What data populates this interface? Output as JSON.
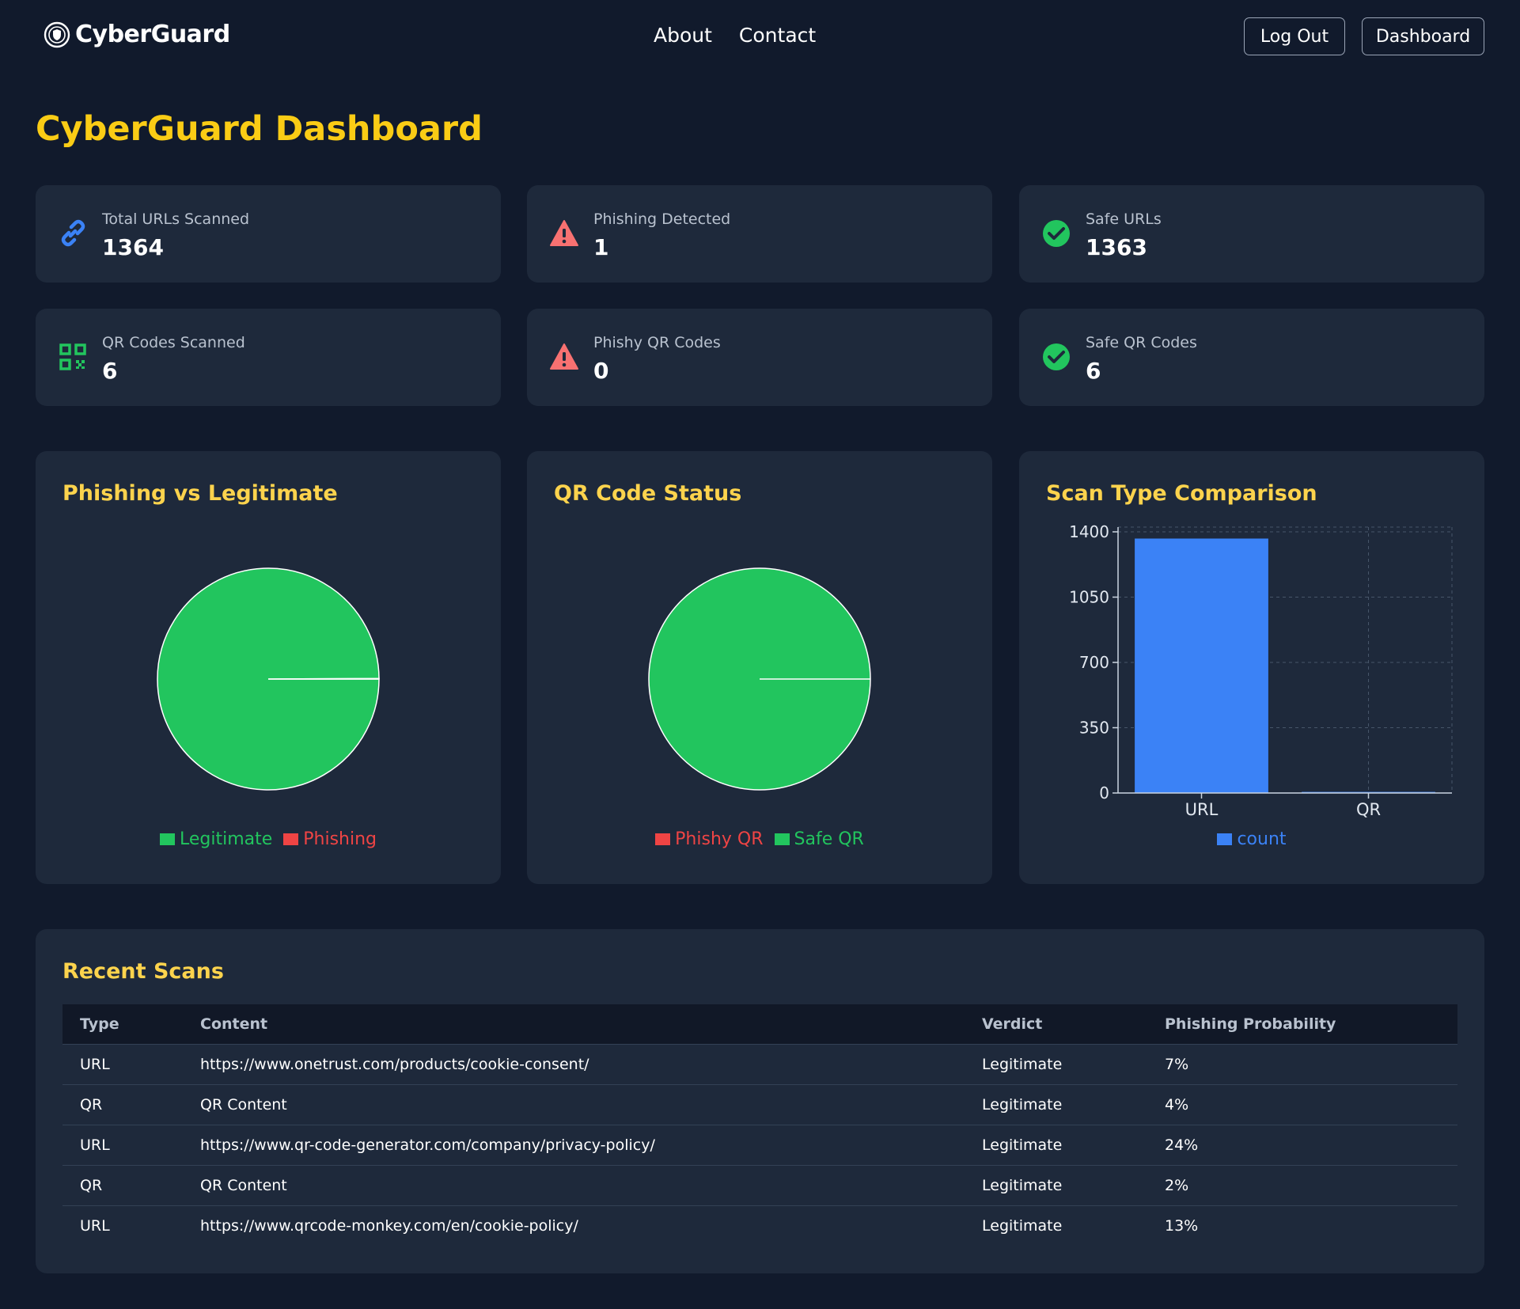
{
  "nav": {
    "brand": "CyberGuard",
    "links": [
      "About",
      "Contact"
    ],
    "logout_label": "Log Out",
    "dashboard_label": "Dashboard"
  },
  "page_title": "CyberGuard Dashboard",
  "stats": [
    {
      "label": "Total URLs Scanned",
      "value": "1364",
      "icon": "link-icon",
      "color": "#3b82f6"
    },
    {
      "label": "Phishing Detected",
      "value": "1",
      "icon": "warning-icon",
      "color": "#f87171"
    },
    {
      "label": "Safe URLs",
      "value": "1363",
      "icon": "check-circle-icon",
      "color": "#22c55e"
    },
    {
      "label": "QR Codes Scanned",
      "value": "6",
      "icon": "qr-code-icon",
      "color": "#22c55e"
    },
    {
      "label": "Phishy QR Codes",
      "value": "0",
      "icon": "warning-icon",
      "color": "#f87171"
    },
    {
      "label": "Safe QR Codes",
      "value": "6",
      "icon": "check-circle-icon",
      "color": "#22c55e"
    }
  ],
  "chart_data": [
    {
      "type": "pie",
      "title": "Phishing vs Legitimate",
      "categories": [
        "Legitimate",
        "Phishing"
      ],
      "values": [
        1363,
        1
      ],
      "colors": [
        "#22c55e",
        "#ef4444"
      ]
    },
    {
      "type": "pie",
      "title": "QR Code Status",
      "categories": [
        "Phishy QR",
        "Safe QR"
      ],
      "values": [
        0,
        6
      ],
      "colors": [
        "#ef4444",
        "#22c55e"
      ]
    },
    {
      "type": "bar",
      "title": "Scan Type Comparison",
      "categories": [
        "URL",
        "QR"
      ],
      "series": [
        {
          "name": "count",
          "values": [
            1364,
            6
          ]
        }
      ],
      "yticks": [
        "0",
        "350",
        "700",
        "1050",
        "1400"
      ],
      "ylim": [
        0,
        1400
      ],
      "grid": true,
      "legend": "bottom",
      "colors": [
        "#3b82f6"
      ]
    }
  ],
  "recent_scans": {
    "title": "Recent Scans",
    "columns": [
      "Type",
      "Content",
      "Verdict",
      "Phishing Probability"
    ],
    "rows": [
      [
        "URL",
        "https://www.onetrust.com/products/cookie-consent/",
        "Legitimate",
        "7%"
      ],
      [
        "QR",
        "QR Content",
        "Legitimate",
        "4%"
      ],
      [
        "URL",
        "https://www.qr-code-generator.com/company/privacy-policy/",
        "Legitimate",
        "24%"
      ],
      [
        "QR",
        "QR Content",
        "Legitimate",
        "2%"
      ],
      [
        "URL",
        "https://www.qrcode-monkey.com/en/cookie-policy/",
        "Legitimate",
        "13%"
      ]
    ]
  }
}
